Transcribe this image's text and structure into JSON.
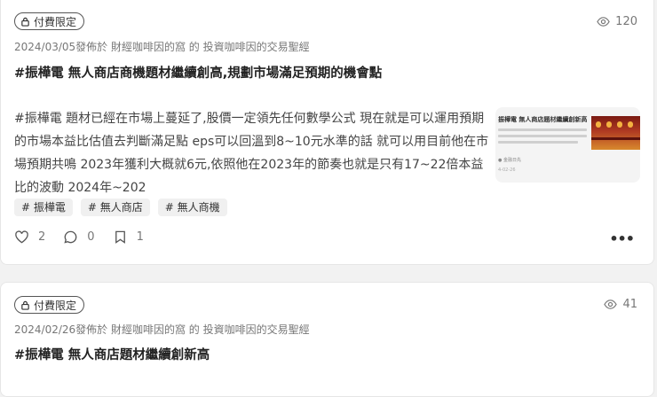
{
  "posts": [
    {
      "badge": "付費限定",
      "views": "120",
      "meta": "2024/03/05發佈於 財經咖啡因的窩 的 投資咖啡因的交易聖經",
      "title": "#振樺電 無人商店商機題材繼續創高,規劃市場滿足預期的機會點",
      "excerpt": "#振樺電 題材已經在市場上蔓延了,股價一定領先任何數學公式 現在就是可以運用預期的市場本益比估值去判斷滿足點 eps可以回溫到8~10元水準的話 就可以用目前他在市場預期共鳴 2023年獲利大概就6元,依照他在2023年的節奏也就是只有17~22倍本益比的波動 2024年~202",
      "thumbnail": {
        "title": "振樺電 無人商店題材繼續創新高",
        "footer": "● 金融日先",
        "date": "4-02-26"
      },
      "tags": [
        "# 振樺電",
        "# 無人商店",
        "# 無人商機"
      ],
      "likes": "2",
      "comments": "0",
      "bookmarks": "1",
      "more": "•••"
    },
    {
      "badge": "付費限定",
      "views": "41",
      "meta": "2024/02/26發佈於 財經咖啡因的窩 的 投資咖啡因的交易聖經",
      "title": "#振樺電 無人商店題材繼續創新高"
    }
  ],
  "icons": {
    "lock": "lock-icon",
    "eye": "eye-icon",
    "heart": "heart-icon",
    "comment": "comment-icon",
    "bookmark": "bookmark-icon",
    "more": "more-icon"
  }
}
